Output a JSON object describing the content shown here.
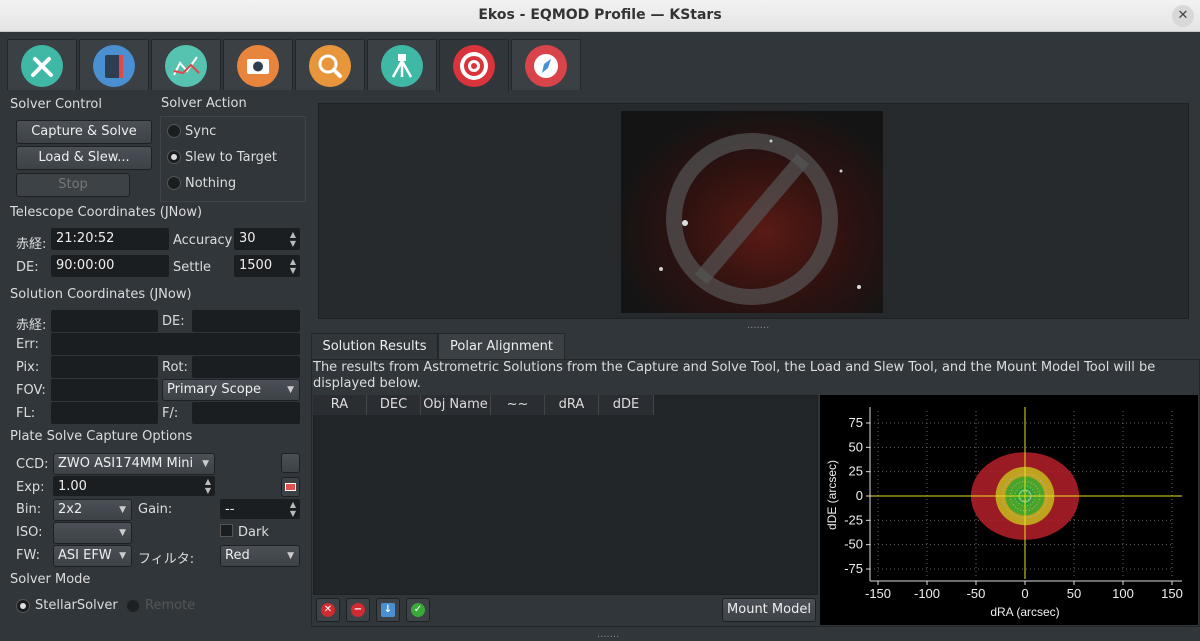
{
  "window": {
    "title": "Ekos - EQMOD Profile — KStars",
    "close_label": "✕"
  },
  "tabs": [
    {
      "name": "setup",
      "icon": "wrench-screwdriver-icon",
      "color": "#3fb8a6"
    },
    {
      "name": "scheduler",
      "icon": "notebook-icon",
      "color": "#4a8fd1"
    },
    {
      "name": "analyze",
      "icon": "graph-icon",
      "color": "#56c2b0"
    },
    {
      "name": "capture",
      "icon": "camera-icon",
      "color": "#e8853c"
    },
    {
      "name": "focus",
      "icon": "magnifier-icon",
      "color": "#e8963c"
    },
    {
      "name": "mount",
      "icon": "tripod-icon",
      "color": "#3fb8a6"
    },
    {
      "name": "align",
      "icon": "target-icon",
      "color": "#d9343b"
    },
    {
      "name": "guide",
      "icon": "compass-icon",
      "color": "#d9444b"
    }
  ],
  "solver_control": {
    "title": "Solver Control",
    "capture_solve": "Capture & Solve",
    "load_slew": "Load & Slew...",
    "stop": "Stop"
  },
  "solver_action": {
    "title": "Solver Action",
    "sync": "Sync",
    "slew": "Slew to Target",
    "nothing": "Nothing",
    "selected": "Slew to Target"
  },
  "telescope": {
    "title": "Telescope Coordinates (JNow)",
    "ra_label": "赤経:",
    "ra_value": "21:20:52",
    "de_label": "DE:",
    "de_value": "90:00:00",
    "accuracy_label": "Accuracy",
    "accuracy_value": "30",
    "settle_label": "Settle",
    "settle_value": "1500"
  },
  "solution": {
    "title": "Solution Coordinates (JNow)",
    "ra_label": "赤経:",
    "de_label": "DE:",
    "err_label": "Err:",
    "pix_label": "Pix:",
    "rot_label": "Rot:",
    "fov_label": "FOV:",
    "scope_value": "Primary Scope",
    "fl_label": "FL:",
    "f_label": "F/:"
  },
  "capture_opts": {
    "title": "Plate Solve Capture Options",
    "ccd_label": "CCD:",
    "ccd_value": "ZWO ASI174MM Mini",
    "exp_label": "Exp:",
    "exp_value": "1.00",
    "bin_label": "Bin:",
    "bin_value": "2x2",
    "gain_label": "Gain:",
    "gain_value": "--",
    "iso_label": "ISO:",
    "dark_label": "Dark",
    "fw_label": "FW:",
    "fw_value": "ASI EFW",
    "filter_label": "フィルタ:",
    "filter_value": "Red"
  },
  "solver_mode": {
    "title": "Solver Mode",
    "stellar": "StellarSolver",
    "remote": "Remote"
  },
  "results": {
    "tab_solution": "Solution Results",
    "tab_polar": "Polar Alignment",
    "description": "The results from Astrometric Solutions from the Capture and Solve Tool, the Load and Slew Tool, and the Mount Model Tool will be displayed below.",
    "columns": [
      "RA",
      "DEC",
      "Obj Name",
      "~~",
      "dRA",
      "dDE"
    ],
    "mount_model": "Mount Model"
  },
  "chart_data": {
    "type": "scatter",
    "xlabel": "dRA (arcsec)",
    "ylabel": "dDE (arcsec)",
    "xlim": [
      -150,
      150
    ],
    "ylim": [
      -75,
      75
    ],
    "xticks": [
      "-150",
      "-100",
      "-50",
      "0",
      "50",
      "100",
      "150"
    ],
    "yticks": [
      "75",
      "50",
      "25",
      "0",
      "-25",
      "-50",
      "-75"
    ],
    "accuracy_rings_arcsec": [
      45,
      30,
      20,
      10
    ],
    "ring_colors": [
      "#b5202a",
      "#c9c41e",
      "#2aa52a",
      "#2aa52a"
    ],
    "points": []
  }
}
